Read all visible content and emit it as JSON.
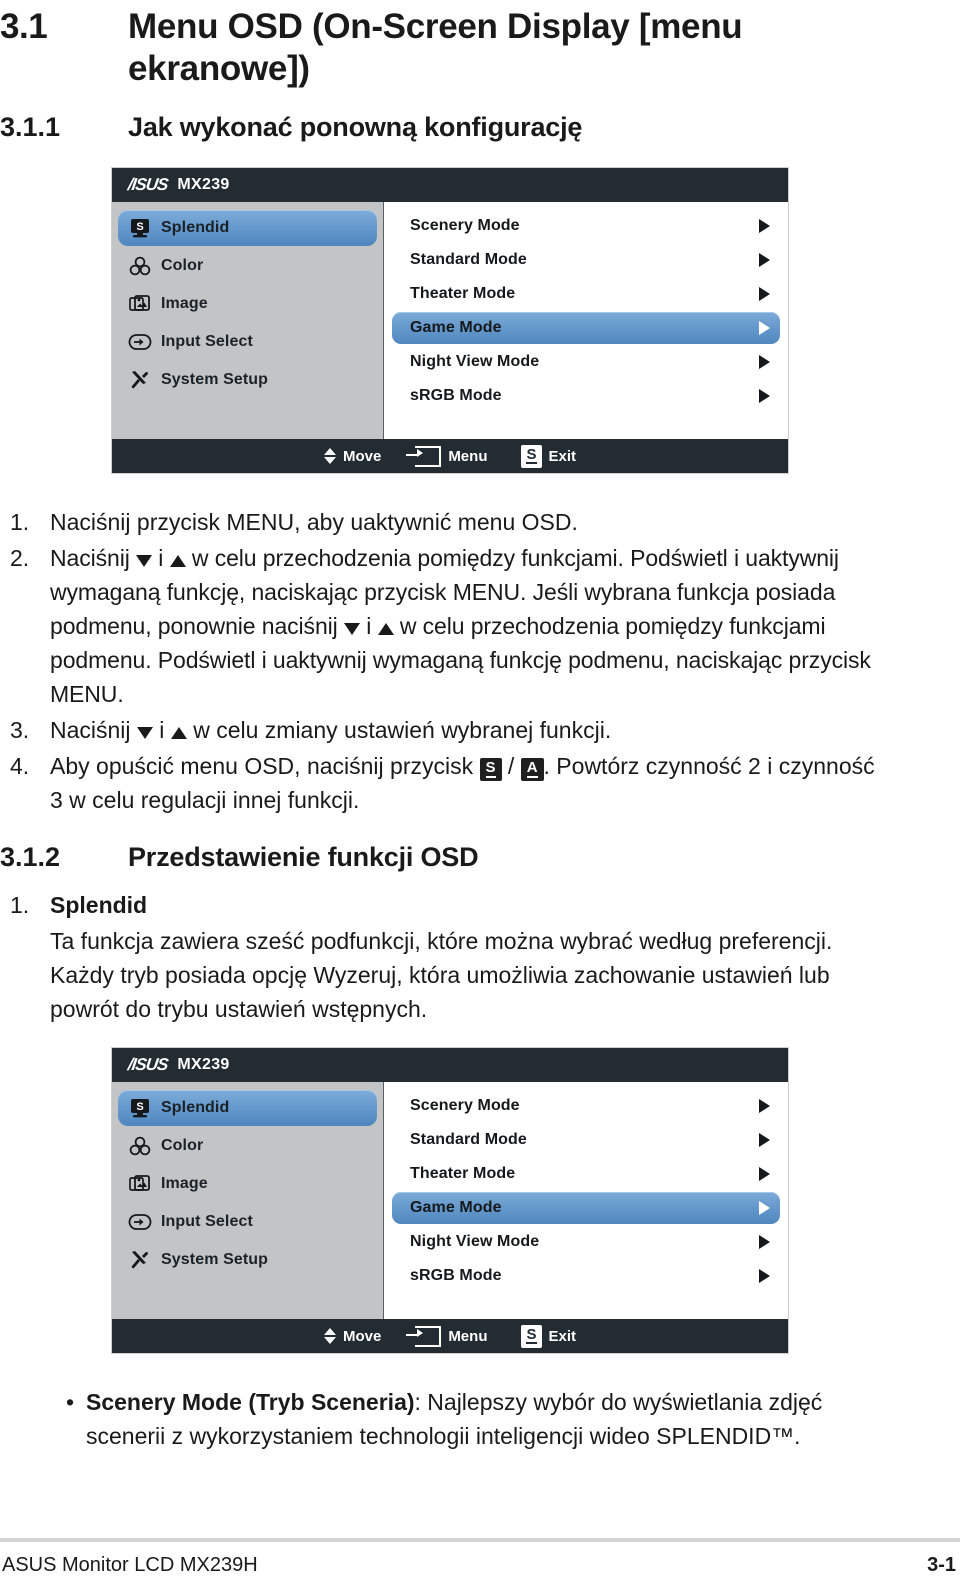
{
  "headings": {
    "h1_num": "3.1",
    "h1_line1": "Menu OSD (On-Screen Display [menu",
    "h1_line2": "ekranowe])",
    "h2_num": "3.1.1",
    "h2_text": "Jak wykonać ponowną konfigurację",
    "h3_num": "3.1.2",
    "h3_text": "Przedstawienie funkcji OSD"
  },
  "steps": [
    {
      "num": "1.",
      "text": "Naciśnij przycisk MENU, aby uaktywnić menu OSD."
    },
    {
      "num": "2.",
      "part1": "Naciśnij ",
      "part2": " i ",
      "part3": " w celu przechodzenia pomiędzy funkcjami. Podświetl i uaktywnij wymaganą funkcję, naciskając przycisk MENU. Jeśli wybrana funkcja posiada podmenu, ponownie naciśnij ",
      "part4": " i ",
      "part5": " w celu przechodzenia pomiędzy funkcjami podmenu. Podświetl i uaktywnij wymaganą funkcję podmenu, naciskając przycisk MENU."
    },
    {
      "num": "3.",
      "part1": "Naciśnij ",
      "part2": " i ",
      "part3": " w celu zmiany ustawień wybranej funkcji."
    },
    {
      "num": "4.",
      "part1": "Aby opuścić menu OSD, naciśnij przycisk ",
      "key1": "S",
      "sep": " / ",
      "key2": "A",
      "part2": ". Powtórz czynność 2 i czynność 3 w celu regulacji innej funkcji."
    }
  ],
  "splendid": {
    "num": "1.",
    "title": "Splendid",
    "body": "Ta funkcja zawiera sześć podfunkcji, które można wybrać według preferencji. Każdy tryb posiada opcję Wyzeruj, która umożliwia zachowanie ustawień lub powrót do trybu ustawień wstępnych."
  },
  "bullet": {
    "dot": "•",
    "bold": "Scenery Mode (Tryb Sceneria)",
    "rest": ": Najlepszy wybór do wyświetlania zdjęć scenerii z wykorzystaniem technologii inteligencji wideo SPLENDID™."
  },
  "osd": {
    "brand": "/ISUS",
    "model": "MX239",
    "sidebar": [
      {
        "label": "Splendid",
        "icon": "splendid-monitor-icon",
        "selected": true
      },
      {
        "label": "Color",
        "icon": "color-palette-icon",
        "selected": false
      },
      {
        "label": "Image",
        "icon": "image-photos-icon",
        "selected": false
      },
      {
        "label": "Input Select",
        "icon": "input-arrow-icon",
        "selected": false
      },
      {
        "label": "System Setup",
        "icon": "tools-wrench-icon",
        "selected": false
      }
    ],
    "items": [
      {
        "label": "Scenery Mode",
        "selected": false
      },
      {
        "label": "Standard Mode",
        "selected": false
      },
      {
        "label": "Theater Mode",
        "selected": false
      },
      {
        "label": "Game Mode",
        "selected": true
      },
      {
        "label": "Night View Mode",
        "selected": false
      },
      {
        "label": "sRGB Mode",
        "selected": false
      }
    ],
    "footer": [
      {
        "label": "Move",
        "icon": "up-down-arrows-icon"
      },
      {
        "label": "Menu",
        "icon": "menu-enter-icon"
      },
      {
        "label": "Exit",
        "icon": "splendid-s-key-icon"
      }
    ],
    "colors": {
      "titlebar": "#232c33",
      "sidebar": "#c2c4c6",
      "highlight": "#5087bf",
      "panel": "#ffffff"
    }
  },
  "footer": {
    "left": "ASUS Monitor LCD MX239H",
    "right": "3-1"
  }
}
